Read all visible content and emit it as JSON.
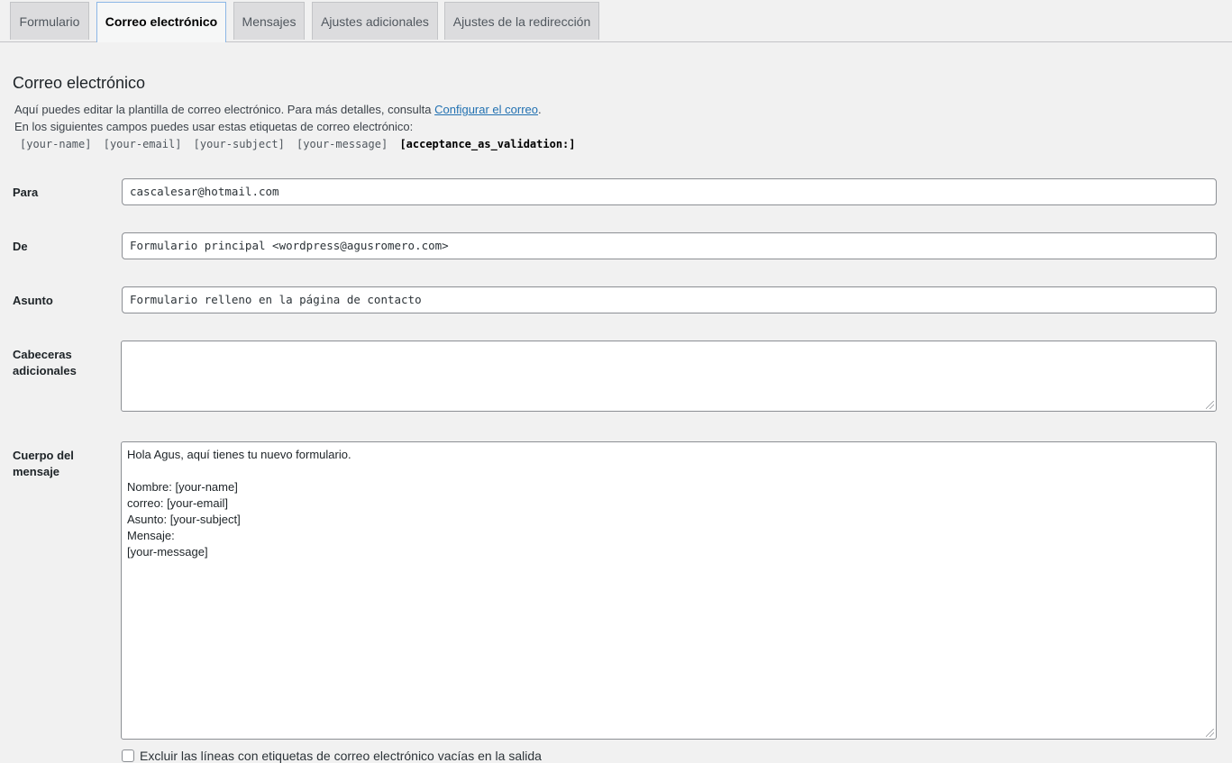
{
  "tabs": [
    "Formulario",
    "Correo electrónico",
    "Mensajes",
    "Ajustes adicionales",
    "Ajustes de la redirección"
  ],
  "section": {
    "title": "Correo electrónico",
    "desc_prefix": "Aquí puedes editar la plantilla de correo electrónico. Para más detalles, consulta ",
    "desc_link": "Configurar el correo",
    "desc_suffix": ".",
    "desc_line2": "En los siguientes campos puedes usar estas etiquetas de correo electrónico:",
    "tags": [
      "[your-name]",
      "[your-email]",
      "[your-subject]",
      "[your-message]"
    ],
    "tag_strong": "[acceptance_as_validation:]"
  },
  "fields": {
    "to_label": "Para",
    "to_value": "cascalesar@hotmail.com",
    "from_label": "De",
    "from_value": "Formulario principal <wordpress@agusromero.com>",
    "subject_label": "Asunto",
    "subject_value": "Formulario relleno en la página de contacto",
    "headers_label_1": "Cabeceras",
    "headers_label_2": "adicionales",
    "body_label_1": "Cuerpo del",
    "body_label_2": "mensaje",
    "body_lines": [
      "Hola Agus, aquí tienes tu nuevo formulario.",
      "",
      "Nombre: [your-name]",
      "correo: [your-email]",
      "Asunto: [your-subject]",
      "Mensaje:",
      "[your-message]"
    ]
  },
  "exclude_label": "Excluir las líneas con etiquetas de correo electrónico vacías en la salida"
}
